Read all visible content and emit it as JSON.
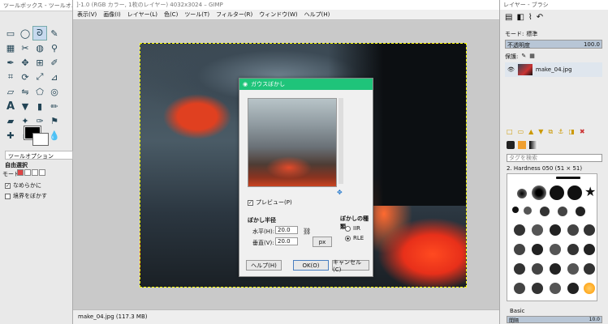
{
  "toolbox": {
    "title": "ツールボックス - ツールオ…",
    "options_tab": "ツールオプション",
    "tool_name": "自由選択",
    "mode_label": "モード:",
    "antialias": "なめらかに",
    "feather": "境界をぼかす"
  },
  "window": {
    "title": "]-1.0 (RGB カラー, 1枚のレイヤー) 4032x3024 – GIMP",
    "menu": [
      "表示(V)",
      "画像(I)",
      "レイヤー(L)",
      "色(C)",
      "ツール(T)",
      "フィルター(R)",
      "ウィンドウ(W)",
      "ヘルプ(H)"
    ]
  },
  "status": {
    "text": "make_04.jpg (117.3 MB)"
  },
  "layers": {
    "title": "レイヤー - ブラシ",
    "mode_label": "モード:",
    "mode_value": "標準",
    "opacity_label": "不透明度",
    "opacity_value": "100.0",
    "lock_label": "保護:",
    "layer_name": "make_04.jpg"
  },
  "brushes": {
    "filter_placeholder": "タグを検索",
    "brush_name": "2. Hardness 050 (51 × 51)",
    "preset": "Basic",
    "spacing_label": "間隔",
    "spacing_value": "10.0"
  },
  "dialog": {
    "title": "ガウスぼかし",
    "preview": "プレビュー(P)",
    "radius_heading": "ぼかし半径",
    "horizontal_label": "水平(H):",
    "horizontal_value": "20.0",
    "vertical_label": "垂直(V):",
    "vertical_value": "20.0",
    "unit": "px",
    "type_heading": "ぼかしの種類",
    "type_iir": "IIR",
    "type_rle": "RLE",
    "help": "ヘルプ(H)",
    "ok": "OK(O)",
    "cancel": "キャンセル(C)"
  }
}
